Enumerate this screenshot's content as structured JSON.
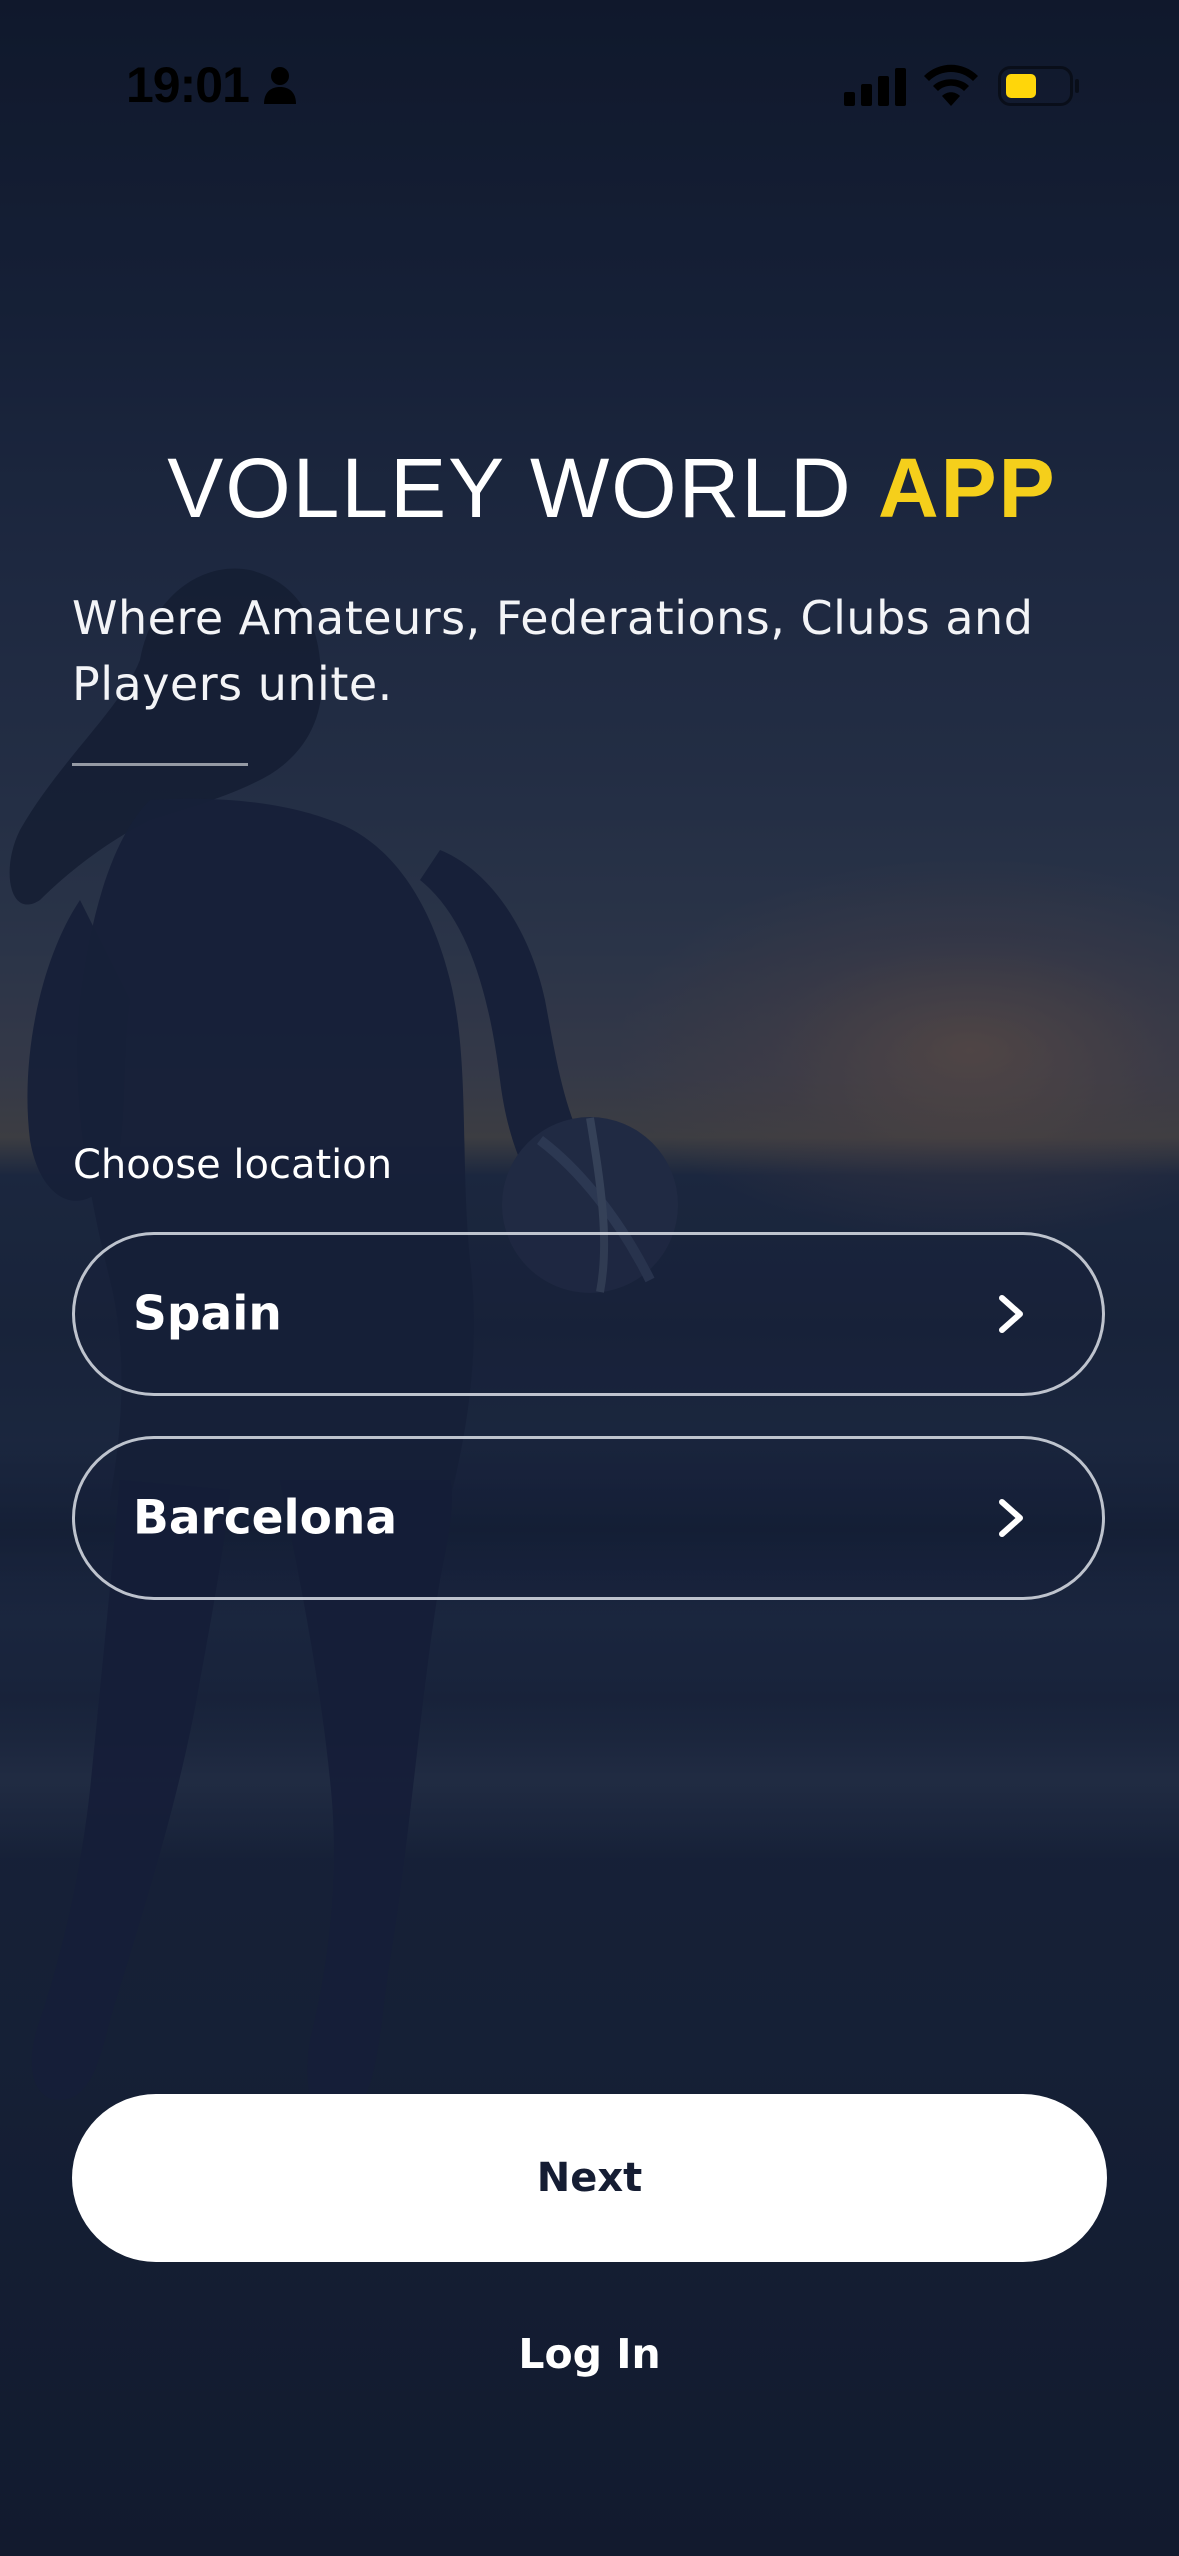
{
  "status_bar": {
    "time": "19:01",
    "icons": [
      "person-icon",
      "cellular-signal-icon",
      "wifi-icon",
      "battery-low-power-icon"
    ],
    "battery_color": "#ffd60a"
  },
  "header": {
    "title_main": "VOLLEY WORLD",
    "title_accent": "APP",
    "accent_color": "#f5cf1b",
    "tagline": "Where Amateurs, Federations, Clubs and Players unite."
  },
  "location": {
    "label": "Choose location",
    "country": "Spain",
    "city": "Barcelona",
    "chevron_icon": "chevron-right-icon"
  },
  "actions": {
    "next_label": "Next",
    "login_label": "Log In"
  }
}
